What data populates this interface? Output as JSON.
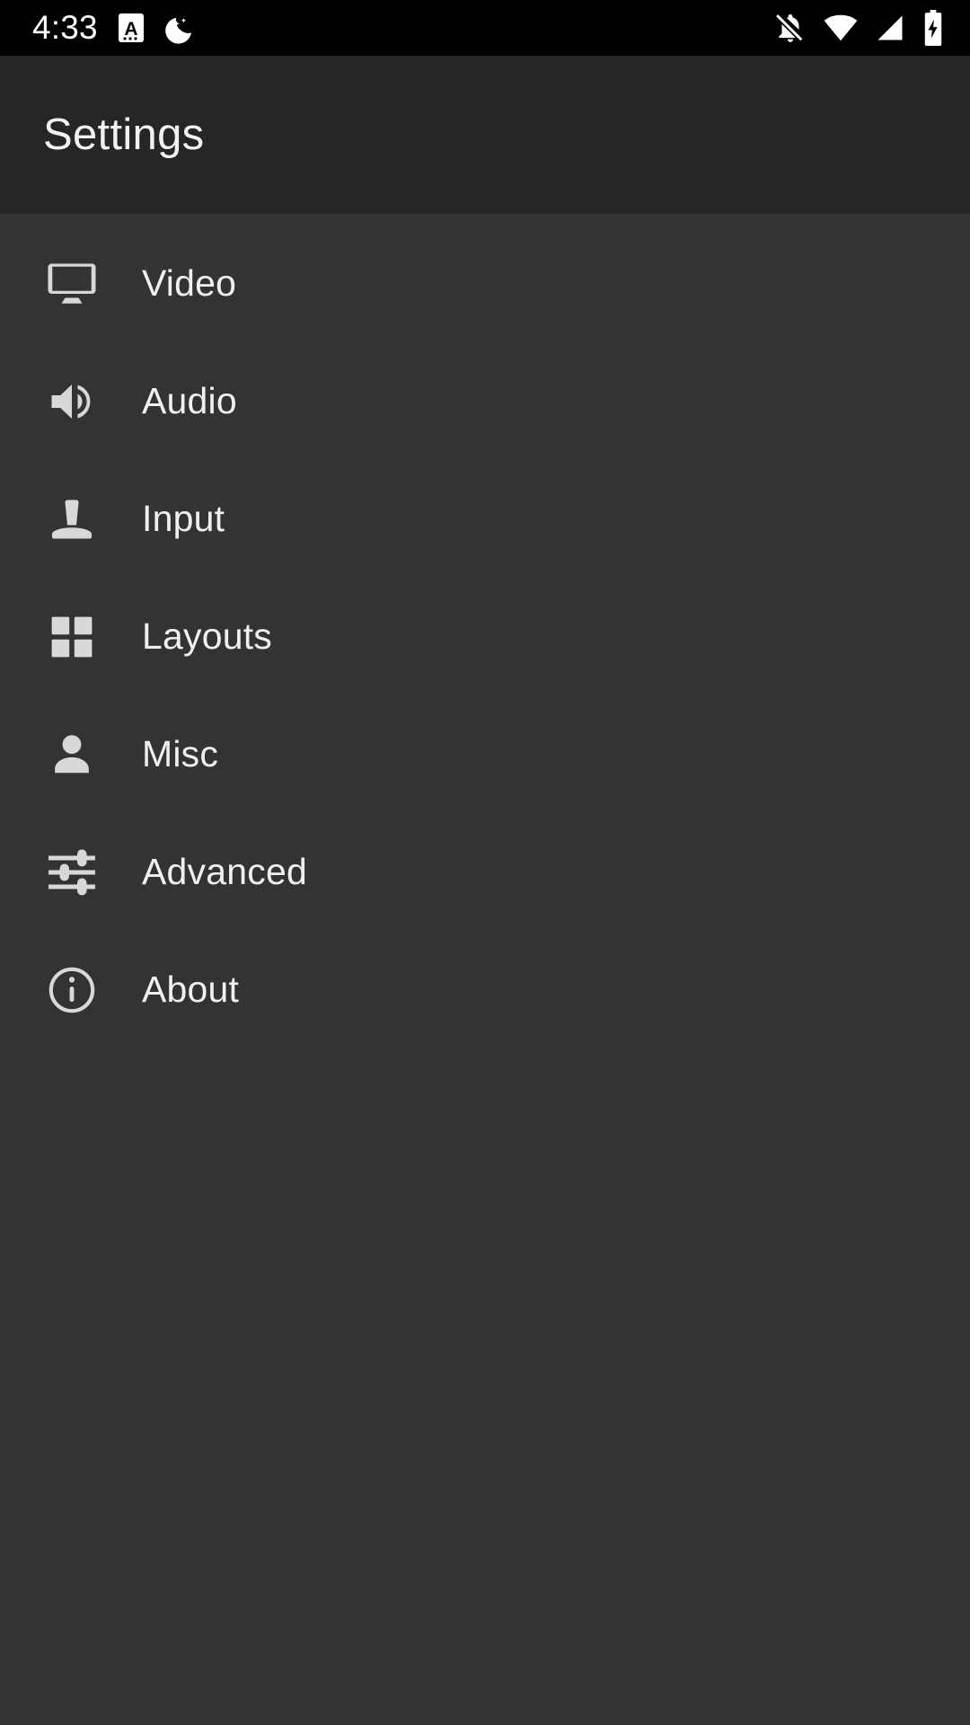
{
  "status_bar": {
    "clock": "4:33",
    "left_icons": [
      {
        "name": "notification-badge-a-icon",
        "glyph": "A"
      },
      {
        "name": "bedtime-moon-icon",
        "glyph": "moon"
      }
    ],
    "right_icons": [
      {
        "name": "notifications-off-icon",
        "glyph": "bell-off"
      },
      {
        "name": "wifi-icon",
        "glyph": "wifi-full"
      },
      {
        "name": "cellular-signal-icon",
        "glyph": "signal"
      },
      {
        "name": "battery-charging-icon",
        "glyph": "battery-bolt"
      }
    ]
  },
  "app_bar": {
    "title": "Settings"
  },
  "menu": {
    "items": [
      {
        "label": "Video",
        "icon": "monitor-icon"
      },
      {
        "label": "Audio",
        "icon": "speaker-volume-icon"
      },
      {
        "label": "Input",
        "icon": "joystick-icon"
      },
      {
        "label": "Layouts",
        "icon": "grid-squares-icon"
      },
      {
        "label": "Misc",
        "icon": "person-icon"
      },
      {
        "label": "Advanced",
        "icon": "sliders-tune-icon"
      },
      {
        "label": "About",
        "icon": "info-circle-icon"
      }
    ]
  },
  "colors": {
    "status_bar_bg": "#000000",
    "app_bar_bg": "#262626",
    "body_bg": "#333333",
    "text_primary": "#f0f0f0",
    "icon_tint": "#d8d8d8"
  }
}
